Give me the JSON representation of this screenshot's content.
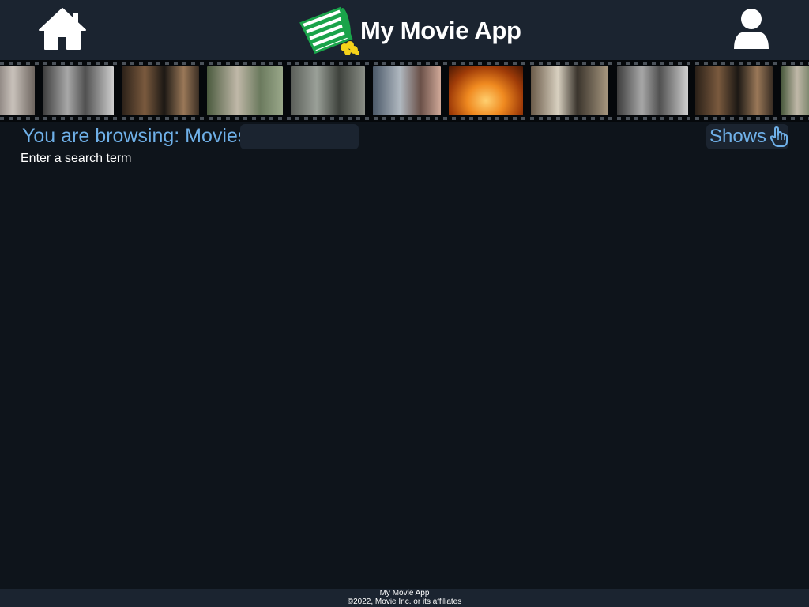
{
  "header": {
    "title": "My Movie App",
    "icons": {
      "home": "home-icon",
      "logo": "popcorn-bucket-icon",
      "user": "user-icon"
    }
  },
  "filmstrip": {
    "frames": [
      "movie-still",
      "movie-still",
      "movie-still",
      "movie-still",
      "movie-still",
      "movie-still",
      "movie-still",
      "movie-still",
      "movie-still",
      "movie-still",
      "movie-still"
    ]
  },
  "browse": {
    "label": "You are browsing: Movies",
    "search_value": "",
    "search_placeholder": "",
    "toggle_label": "Shows",
    "toggle_icon": "pointing-hand-icon"
  },
  "hint": "Enter a search term",
  "footer": {
    "line1": "My Movie App",
    "line2": "©2022, Movie Inc. or its affiliates"
  },
  "colors": {
    "header_bg": "#1b2430",
    "page_bg": "#0e141b",
    "accent": "#6fb0e8",
    "logo_green": "#1aa34a",
    "popcorn_yellow": "#f5d21a"
  }
}
